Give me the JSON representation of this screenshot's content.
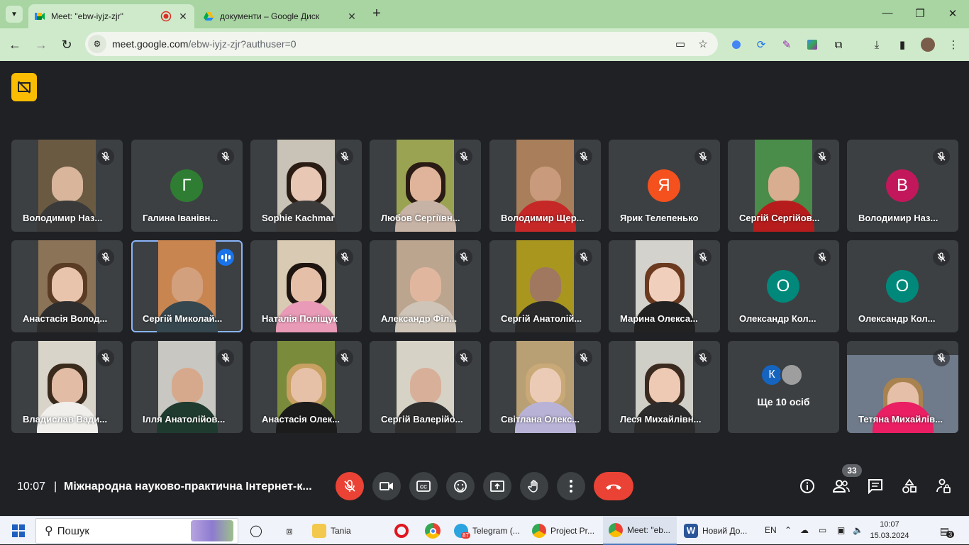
{
  "browser": {
    "tabs": [
      {
        "title": "Meet: \"ebw-iyjz-zjr\"",
        "active": true
      },
      {
        "title": "документи – Google Диск",
        "active": false
      }
    ],
    "url_host": "meet.google.com",
    "url_path": "/ebw-iyjz-zjr?authuser=0"
  },
  "meet": {
    "tiles": [
      {
        "name": "Володимир Наз...",
        "kind": "video",
        "bg": "#6b5a42",
        "skin": "#d9b59c",
        "shirt": "#3a3a3a"
      },
      {
        "name": "Галина Іванівн...",
        "kind": "avatar",
        "initial": "Г",
        "color": "#2e7d32"
      },
      {
        "name": "Sophie Kachmar",
        "kind": "video",
        "bg": "#c8c3b6",
        "skin": "#e8c7b4",
        "shirt": "#3c3c3c",
        "hair": "#2b1d14"
      },
      {
        "name": "Любов Сергіївн...",
        "kind": "video",
        "bg": "#9aa352",
        "skin": "#e0b49b",
        "shirt": "#c7b3a6",
        "hair": "#2a1c14"
      },
      {
        "name": "Володимир Щер...",
        "kind": "video",
        "bg": "#a87f5a",
        "skin": "#c99b7c",
        "shirt": "#c62828"
      },
      {
        "name": "Ярик Телепенько",
        "kind": "avatar",
        "initial": "Я",
        "color": "#f4511e"
      },
      {
        "name": "Сергій Сергійов...",
        "kind": "video",
        "bg": "#4a8c4a",
        "skin": "#d8ad90",
        "shirt": "#b71c1c"
      },
      {
        "name": "Володимир Наз...",
        "kind": "avatar",
        "initial": "В",
        "color": "#c2185b"
      },
      {
        "name": "Анастасія Волод...",
        "kind": "video",
        "bg": "#8a7356",
        "skin": "#e8c4ad",
        "shirt": "#2e2e2e",
        "hair": "#5a3b24"
      },
      {
        "name": "Сергій Миколай...",
        "kind": "video",
        "bg": "#c98550",
        "skin": "#d3a07e",
        "shirt": "#37474f",
        "speaking": true
      },
      {
        "name": "Наталія Поліщук",
        "kind": "video",
        "bg": "#d9cbb3",
        "skin": "#e6bfa8",
        "shirt": "#e89ab7",
        "hair": "#1e1410"
      },
      {
        "name": "Александр Філ...",
        "kind": "video",
        "bg": "#bba58e",
        "skin": "#e0b79e",
        "shirt": "#cfc4b8"
      },
      {
        "name": "Сергій Анатолій...",
        "kind": "video",
        "bg": "#a8961f",
        "skin": "#a07860",
        "shirt": "#2a2a2a"
      },
      {
        "name": "Марина Олекса...",
        "kind": "video",
        "bg": "#d4d2cc",
        "skin": "#f0d0bc",
        "shirt": "#222222",
        "hair": "#6b3a1f"
      },
      {
        "name": "Олександр Кол...",
        "kind": "avatar",
        "initial": "О",
        "color": "#00897b"
      },
      {
        "name": "Олександр Кол...",
        "kind": "avatar",
        "initial": "О",
        "color": "#00897b"
      },
      {
        "name": "Владислав Вади...",
        "kind": "video",
        "bg": "#d9d4ca",
        "skin": "#e2bca4",
        "shirt": "#f0efec",
        "hair": "#3a2a1c"
      },
      {
        "name": "Ілля Анатолійов...",
        "kind": "video",
        "bg": "#c9c7c2",
        "skin": "#d6a98d",
        "shirt": "#1f3b2f"
      },
      {
        "name": "Анастасія Олек...",
        "kind": "video",
        "bg": "#7a8b3c",
        "skin": "#e6c1a8",
        "shirt": "#1c1c1c",
        "hair": "#c8a062"
      },
      {
        "name": "Сергій Валерійо...",
        "kind": "video",
        "bg": "#d7d2c6",
        "skin": "#d8b09a",
        "shirt": "#2f2f2f"
      },
      {
        "name": "Світлана Олекс...",
        "kind": "video",
        "bg": "#b9a074",
        "skin": "#eccbb6",
        "shirt": "#b8b3d6",
        "hair": "#c9a977"
      },
      {
        "name": "Леся Михайлівн...",
        "kind": "video",
        "bg": "#d0cfc7",
        "skin": "#eecab4",
        "shirt": "#2c2c2c",
        "hair": "#3b2a1f"
      },
      {
        "name": "Ще 10 осіб",
        "kind": "more",
        "initials": [
          "К",
          ""
        ]
      },
      {
        "name": "Тетяна Михайлів...",
        "kind": "wide",
        "bg": "#6f7a8a",
        "skin": "#e6bfa8",
        "shirt": "#e91e63",
        "hair": "#a9834f"
      }
    ],
    "time": "10:07",
    "separator": "|",
    "meeting_title": "Міжнародна науково-практична Інтернет-к...",
    "participants_badge": "33"
  },
  "taskbar": {
    "search_placeholder": "Пошук",
    "items": [
      "Tania",
      "Telegram (...",
      "Project Pr...",
      "Meet: \"eb...",
      "Новий До..."
    ],
    "telegram_badge": "87",
    "lang": "EN",
    "time": "10:07",
    "date": "15.03.2024",
    "notif_count": "3"
  }
}
